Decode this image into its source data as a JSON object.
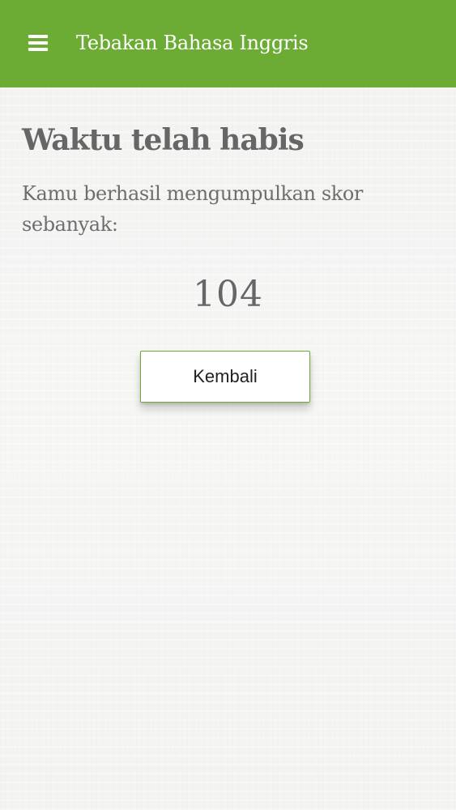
{
  "app_bar": {
    "title": "Tebakan Bahasa Inggris",
    "menu_icon": "hamburger-menu-icon",
    "color": "#6cac35"
  },
  "result": {
    "heading": "Waktu telah habis",
    "message": "Kamu berhasil mengumpulkan skor sebanyak:",
    "score": "104"
  },
  "actions": {
    "back_label": "Kembali"
  }
}
